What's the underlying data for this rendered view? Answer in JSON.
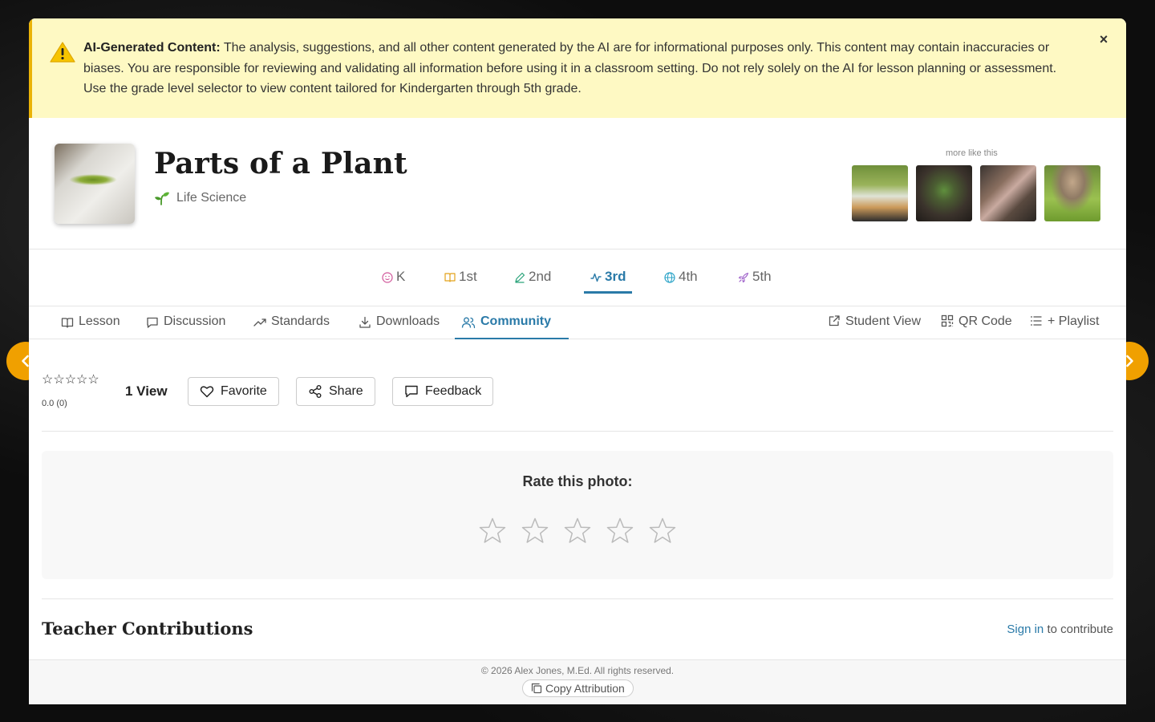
{
  "alert": {
    "heading": "AI-Generated Content:",
    "body": " The analysis, suggestions, and all other content generated by the AI are for informational purposes only. This content may contain inaccuracies or biases. You are responsible for reviewing and validating all information before using it in a classroom setting. Do not rely solely on the AI for lesson planning or assessment. Use the grade level selector to view content tailored for Kindergarten through 5th grade.",
    "close_label": "×"
  },
  "header": {
    "title": "Parts of a Plant",
    "subject": "Life Science",
    "more_label": "more like this"
  },
  "grades": [
    {
      "label": "K",
      "icon": "smile-icon"
    },
    {
      "label": "1st",
      "icon": "book-icon"
    },
    {
      "label": "2nd",
      "icon": "pencil-icon"
    },
    {
      "label": "3rd",
      "icon": "activity-icon",
      "active": true
    },
    {
      "label": "4th",
      "icon": "globe-icon"
    },
    {
      "label": "5th",
      "icon": "rocket-icon"
    }
  ],
  "sections": {
    "tabs": [
      {
        "label": "Lesson",
        "icon": "book-open-icon"
      },
      {
        "label": "Discussion",
        "icon": "message-icon"
      },
      {
        "label": "Standards",
        "icon": "trending-up-icon"
      },
      {
        "label": "Downloads",
        "icon": "download-icon"
      },
      {
        "label": "Community",
        "icon": "users-icon",
        "active": true
      }
    ],
    "actions": [
      {
        "label": "Student View",
        "icon": "external-link-icon"
      },
      {
        "label": "QR Code",
        "icon": "qr-code-icon"
      },
      {
        "label": "+ Playlist",
        "icon": "list-icon"
      }
    ]
  },
  "community": {
    "mini_stars": "☆☆☆☆☆",
    "score": "0.0 (0)",
    "views": "1 View",
    "favorite_label": "Favorite",
    "share_label": "Share",
    "feedback_label": "Feedback",
    "rate_title": "Rate this photo:",
    "rating_value": 0,
    "rating_max": 5,
    "contrib_title": "Teacher Contributions",
    "sign_in_label": "Sign in",
    "contribute_suffix": " to contribute"
  },
  "footer": {
    "copyright": "© 2026 Alex Jones, M.Ed. All rights reserved.",
    "copy_attribution": "Copy Attribution"
  },
  "colors": {
    "accent": "#2a7aa8",
    "nav_button": "#f0a000",
    "alert_bg": "#fef9c3",
    "alert_border": "#eab308"
  }
}
